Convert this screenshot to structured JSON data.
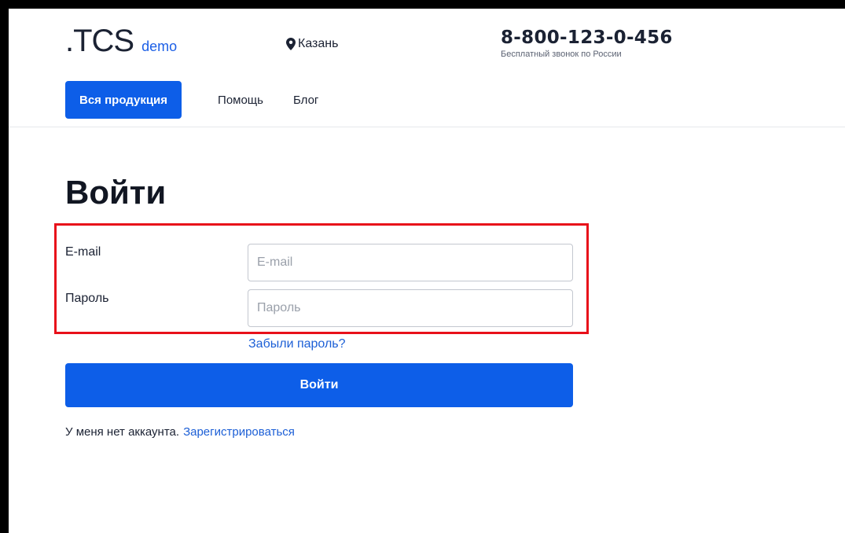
{
  "header": {
    "logo_main": ".TCS",
    "logo_sub": "demo",
    "city": "Казань",
    "phone": "8-800-123-0-456",
    "phone_caption": "Бесплатный звонок по России",
    "nav": {
      "products_button": "Вся продукция",
      "help_link": "Помощь",
      "blog_link": "Блог"
    }
  },
  "login": {
    "title": "Войти",
    "email": {
      "label": "E-mail",
      "placeholder": "E-mail",
      "value": ""
    },
    "password": {
      "label": "Пароль",
      "placeholder": "Пароль",
      "value": ""
    },
    "forgot_link": "Забыли пароль?",
    "submit_button": "Войти",
    "no_account_text": "У меня нет аккаунта.",
    "register_link": "Зарегистрироваться"
  },
  "icons": {
    "city": "map-pin-icon"
  },
  "colors": {
    "primary": "#0d5ee8",
    "link": "#1c5fd6",
    "highlight": "#e8101a",
    "text": "#1b2233"
  }
}
